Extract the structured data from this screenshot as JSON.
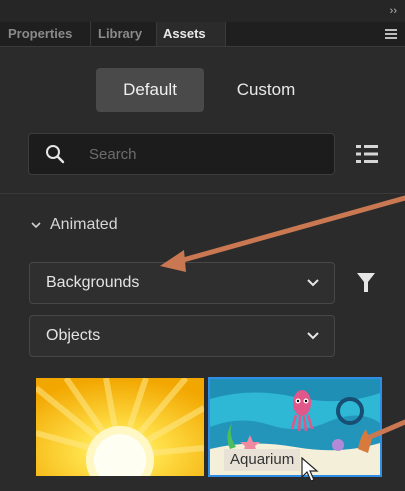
{
  "panel": {
    "tabs": [
      "Properties",
      "Library",
      "Assets"
    ],
    "active_tab": "Assets"
  },
  "view_toggle": {
    "default_label": "Default",
    "custom_label": "Custom",
    "selected": "Default"
  },
  "search": {
    "placeholder": "Search"
  },
  "section": {
    "label": "Animated",
    "expanded": true
  },
  "dropdowns": {
    "category": "Backgrounds",
    "type": "Objects"
  },
  "assets": [
    {
      "label": ""
    },
    {
      "label": "Aquarium",
      "selected": true
    }
  ],
  "colors": {
    "selection": "#2f8fe6",
    "annotation_arrow": "#c97852"
  }
}
